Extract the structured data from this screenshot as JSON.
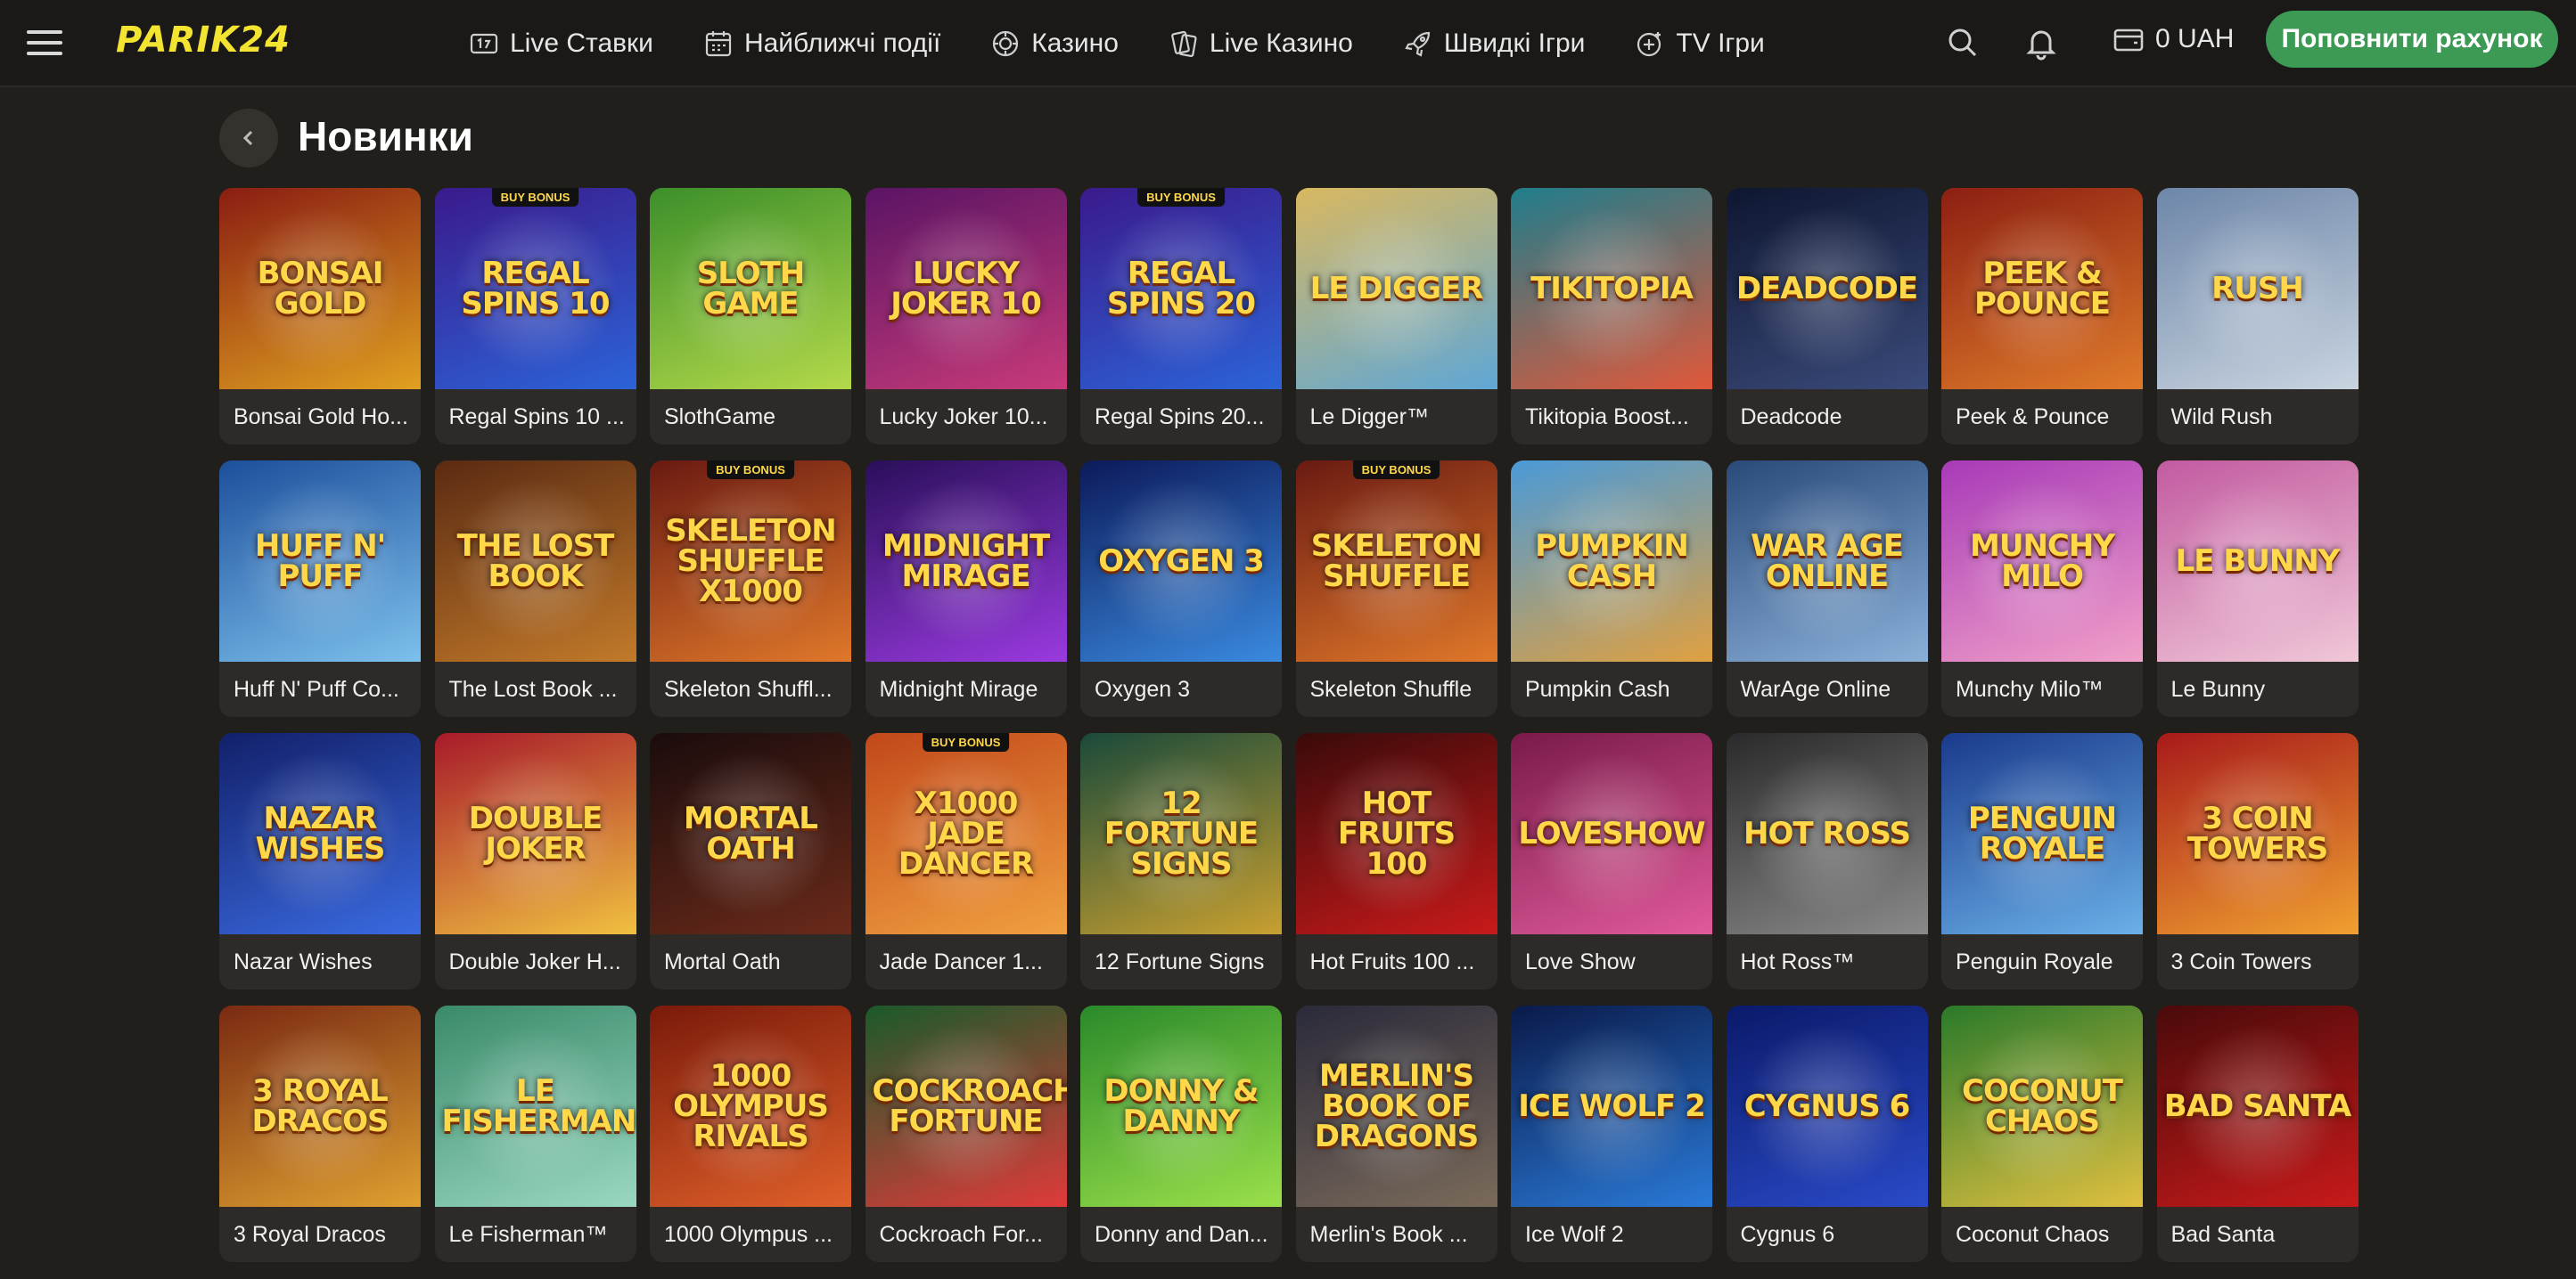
{
  "header": {
    "logo": "PARIK24",
    "nav": [
      {
        "label": "Live Ставки",
        "icon": "live-bets-icon"
      },
      {
        "label": "Найближчі події",
        "icon": "calendar-icon"
      },
      {
        "label": "Казино",
        "icon": "casino-chip-icon"
      },
      {
        "label": "Live Казино",
        "icon": "cards-icon"
      },
      {
        "label": "Швидкі Ігри",
        "icon": "rocket-icon"
      },
      {
        "label": "TV Ігри",
        "icon": "tv-games-icon"
      }
    ],
    "balance": "0 UAH",
    "deposit_label": "Поповнити рахунок"
  },
  "section": {
    "title": "Новинки"
  },
  "games": [
    {
      "name": "Bonsai Gold Ho...",
      "art": "Bonsai Gold",
      "buy_bonus": false,
      "c1": "#8a1d12",
      "c2": "#e0a020"
    },
    {
      "name": "Regal Spins 10 ...",
      "art": "Regal Spins 10",
      "buy_bonus": true,
      "c1": "#3a1a8c",
      "c2": "#2c63d8"
    },
    {
      "name": "SlothGame",
      "art": "Sloth Game",
      "buy_bonus": false,
      "c1": "#3c8f2a",
      "c2": "#b3d94a"
    },
    {
      "name": "Lucky Joker 10...",
      "art": "Lucky Joker 10",
      "buy_bonus": false,
      "c1": "#5a1464",
      "c2": "#c73a7a"
    },
    {
      "name": "Regal Spins 20...",
      "art": "Regal Spins 20",
      "buy_bonus": true,
      "c1": "#3a1a8c",
      "c2": "#2c63d8"
    },
    {
      "name": "Le Digger™",
      "art": "Le Digger",
      "buy_bonus": false,
      "c1": "#d9b860",
      "c2": "#5fa7d6"
    },
    {
      "name": "Tikitopia Boost...",
      "art": "Tikitopia",
      "buy_bonus": false,
      "c1": "#1f7d8c",
      "c2": "#e0583a"
    },
    {
      "name": "Deadcode",
      "art": "Deadcode",
      "buy_bonus": false,
      "c1": "#0e1630",
      "c2": "#3a4a7a"
    },
    {
      "name": "Peek & Pounce",
      "art": "Peek & Pounce",
      "buy_bonus": false,
      "c1": "#8c1f12",
      "c2": "#e07a2a"
    },
    {
      "name": "Wild Rush",
      "art": "Rush",
      "buy_bonus": false,
      "c1": "#6d86a8",
      "c2": "#c9d4e0"
    },
    {
      "name": "Huff N' Puff Co...",
      "art": "Huff N' Puff",
      "buy_bonus": false,
      "c1": "#1d4f9c",
      "c2": "#7cc0ec"
    },
    {
      "name": "The Lost Book ...",
      "art": "The Lost Book",
      "buy_bonus": false,
      "c1": "#5a2a12",
      "c2": "#c27a2a"
    },
    {
      "name": "Skeleton Shuffl...",
      "art": "Skeleton Shuffle x1000",
      "buy_bonus": true,
      "c1": "#6a1a12",
      "c2": "#e0782a"
    },
    {
      "name": "Midnight Mirage",
      "art": "Midnight Mirage",
      "buy_bonus": false,
      "c1": "#2a0f5a",
      "c2": "#9a3ae0"
    },
    {
      "name": "Oxygen 3",
      "art": "Oxygen 3",
      "buy_bonus": false,
      "c1": "#0c1a5a",
      "c2": "#3a8ae0"
    },
    {
      "name": "Skeleton Shuffle",
      "art": "Skeleton Shuffle",
      "buy_bonus": true,
      "c1": "#6a1a12",
      "c2": "#e0782a"
    },
    {
      "name": "Pumpkin Cash",
      "art": "Pumpkin Cash",
      "buy_bonus": false,
      "c1": "#4a9ad8",
      "c2": "#e0a040"
    },
    {
      "name": "WarAge Online",
      "art": "War Age Online",
      "buy_bonus": false,
      "c1": "#2a4a7a",
      "c2": "#8ab0d8"
    },
    {
      "name": "Munchy Milo™",
      "art": "Munchy Milo",
      "buy_bonus": false,
      "c1": "#a83ab8",
      "c2": "#f0a0c8"
    },
    {
      "name": "Le Bunny",
      "art": "Le Bunny",
      "buy_bonus": false,
      "c1": "#c25aa0",
      "c2": "#f0c8d8"
    },
    {
      "name": "Nazar Wishes",
      "art": "Nazar Wishes",
      "buy_bonus": false,
      "c1": "#12206a",
      "c2": "#3a6ae0"
    },
    {
      "name": "Double Joker H...",
      "art": "Double Joker",
      "buy_bonus": false,
      "c1": "#a81a2a",
      "c2": "#f0c040"
    },
    {
      "name": "Mortal Oath",
      "art": "Mortal Oath",
      "buy_bonus": false,
      "c1": "#1a0c0c",
      "c2": "#6a2a1a"
    },
    {
      "name": "Jade Dancer 1...",
      "art": "x1000 Jade Dancer",
      "buy_bonus": true,
      "c1": "#c2481a",
      "c2": "#f0a040"
    },
    {
      "name": "12 Fortune Signs",
      "art": "12 Fortune Signs",
      "buy_bonus": false,
      "c1": "#1a4a3a",
      "c2": "#c8a030"
    },
    {
      "name": "Hot Fruits 100 ...",
      "art": "Hot Fruits 100",
      "buy_bonus": false,
      "c1": "#3a0a0a",
      "c2": "#c81a1a"
    },
    {
      "name": "Love Show",
      "art": "Loveshow",
      "buy_bonus": false,
      "c1": "#7a1a4a",
      "c2": "#e05a9a"
    },
    {
      "name": "Hot Ross™",
      "art": "Hot Ross",
      "buy_bonus": false,
      "c1": "#2a2a2a",
      "c2": "#8a8a8a"
    },
    {
      "name": "Penguin Royale",
      "art": "Penguin Royale",
      "buy_bonus": false,
      "c1": "#1a3a8c",
      "c2": "#6ab0e8"
    },
    {
      "name": "3 Coin Towers",
      "art": "3 Coin Towers",
      "buy_bonus": false,
      "c1": "#a81a1a",
      "c2": "#f0a030"
    },
    {
      "name": "3 Royal Dracos",
      "art": "3 Royal Dracos",
      "buy_bonus": false,
      "c1": "#7a2a12",
      "c2": "#e0a030"
    },
    {
      "name": "Le Fisherman™",
      "art": "Le Fisherman",
      "buy_bonus": false,
      "c1": "#3a8a6a",
      "c2": "#9ad8c0"
    },
    {
      "name": "1000 Olympus ...",
      "art": "1000 Olympus Rivals",
      "buy_bonus": false,
      "c1": "#7a1a0a",
      "c2": "#e0602a"
    },
    {
      "name": "Cockroach For...",
      "art": "Cockroach Fortune",
      "buy_bonus": false,
      "c1": "#1a5a2a",
      "c2": "#e03a3a"
    },
    {
      "name": "Donny and Dan...",
      "art": "Donny & Danny",
      "buy_bonus": false,
      "c1": "#2a8a2a",
      "c2": "#9ae04a"
    },
    {
      "name": "Merlin's Book ...",
      "art": "Merlin's Book of Dragons",
      "buy_bonus": false,
      "c1": "#2a2a3a",
      "c2": "#7a6a5a"
    },
    {
      "name": "Ice Wolf 2",
      "art": "Ice Wolf 2",
      "buy_bonus": false,
      "c1": "#0a1a4a",
      "c2": "#2a7ad8"
    },
    {
      "name": "Cygnus 6",
      "art": "Cygnus 6",
      "buy_bonus": false,
      "c1": "#0a1a6a",
      "c2": "#2a4ac8"
    },
    {
      "name": "Coconut Chaos",
      "art": "Coconut Chaos",
      "buy_bonus": false,
      "c1": "#2a7a2a",
      "c2": "#e0c040"
    },
    {
      "name": "Bad Santa",
      "art": "Bad Santa",
      "buy_bonus": false,
      "c1": "#4a0a0a",
      "c2": "#c81a1a"
    }
  ],
  "buy_bonus_label": "BUY BONUS",
  "colors": {
    "background": "#211f1c",
    "topbar": "#1a1917",
    "logo": "#f2e431",
    "deposit_button": "#3c9a55",
    "card": "#2d2a27"
  }
}
